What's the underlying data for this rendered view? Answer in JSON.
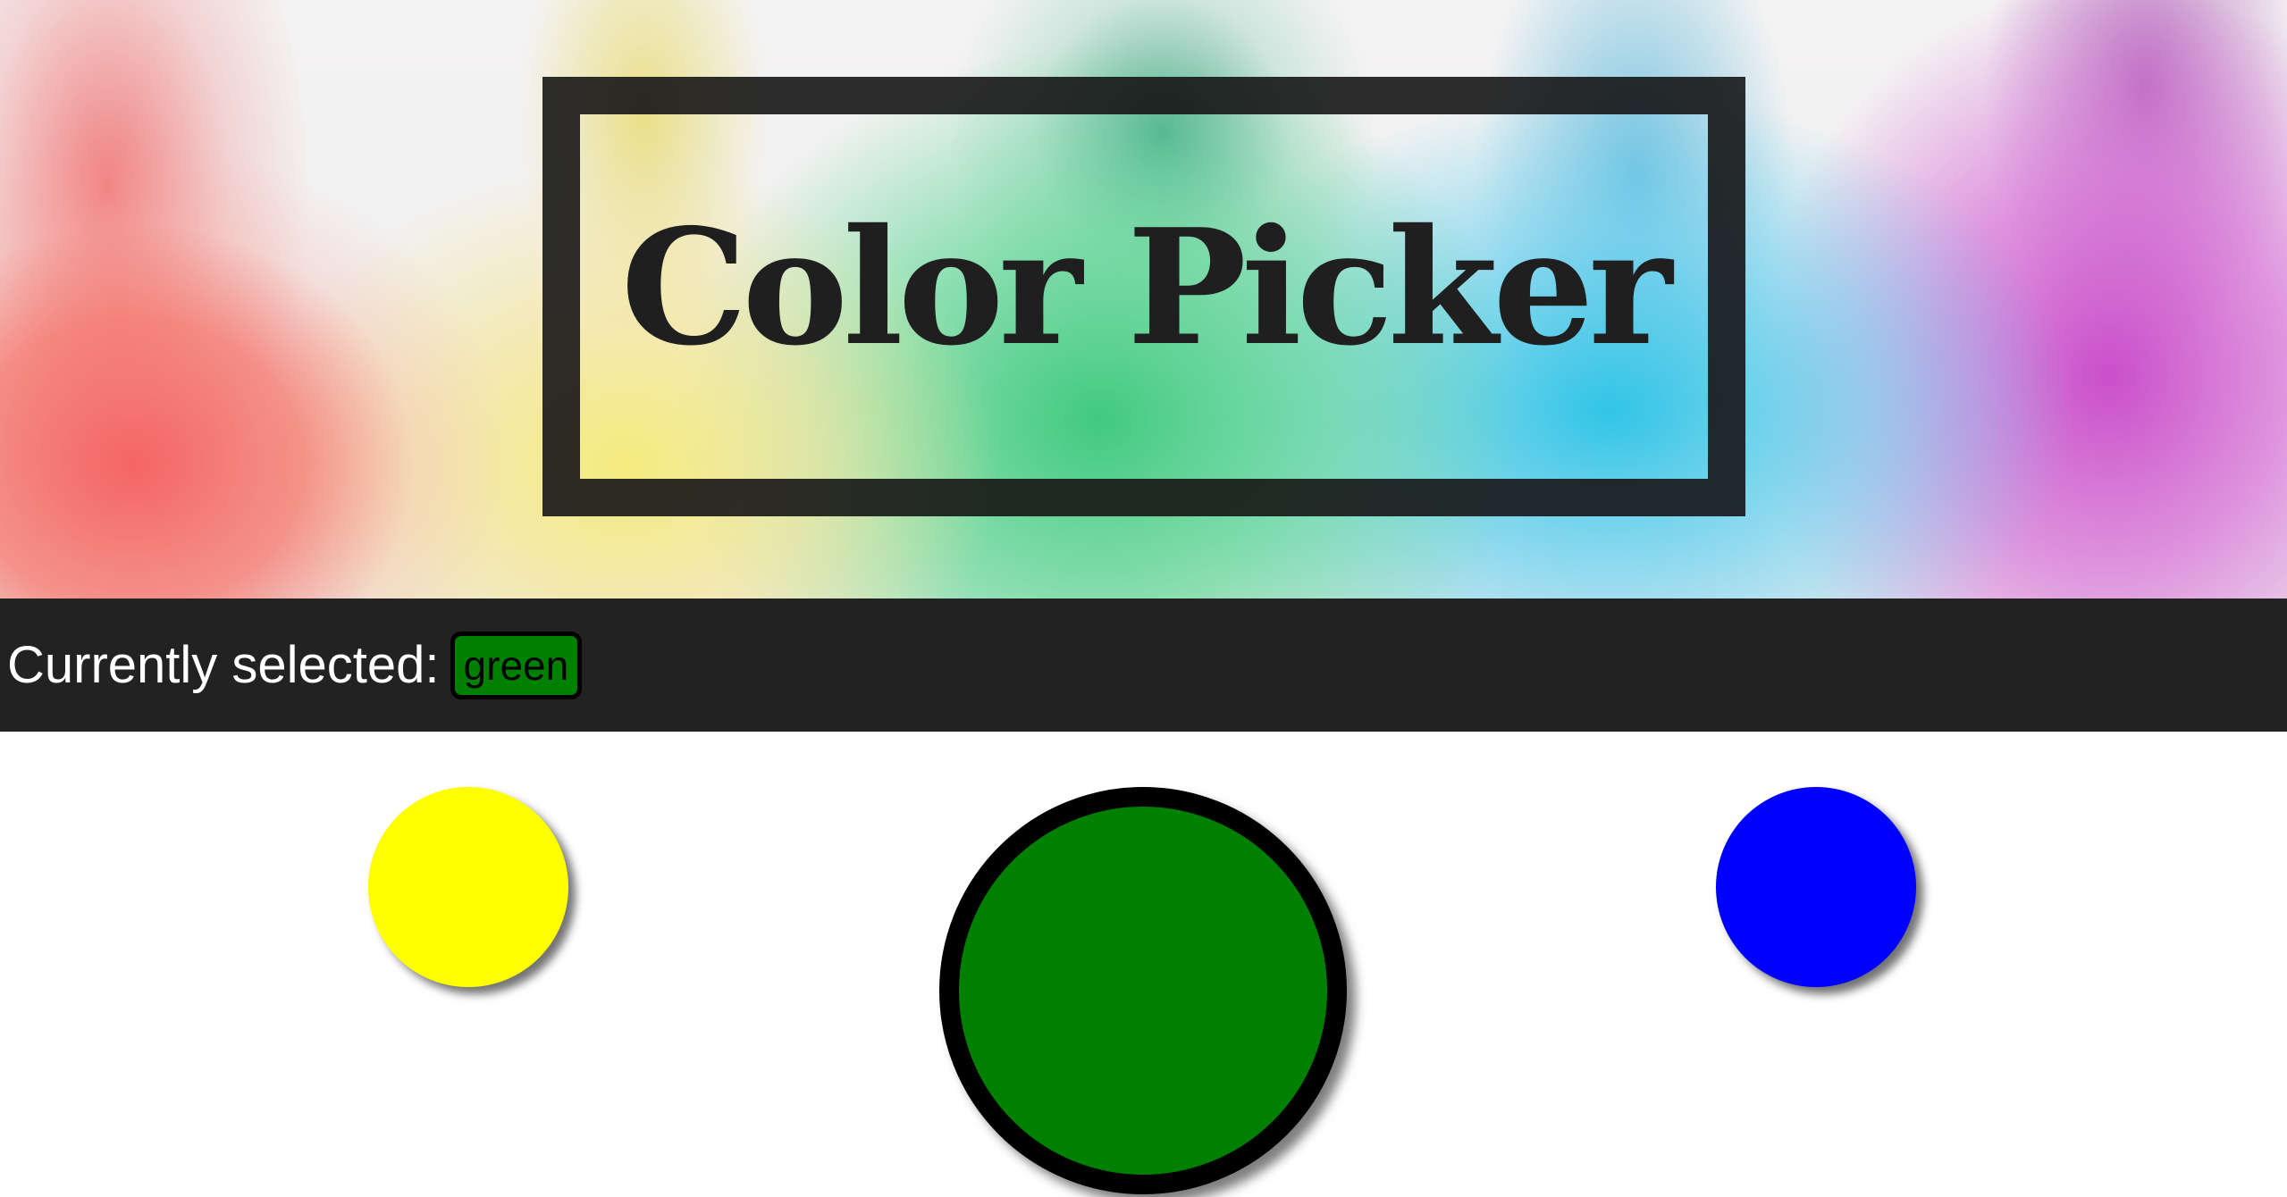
{
  "hero": {
    "title": "Color Picker"
  },
  "status": {
    "label": "Currently selected:",
    "selected_value": "green",
    "selected_color": "#008000"
  },
  "swatches": [
    {
      "name": "yellow",
      "color": "#ffff00",
      "selected": false
    },
    {
      "name": "green",
      "color": "#008000",
      "selected": true
    },
    {
      "name": "blue",
      "color": "#0000ff",
      "selected": false
    }
  ]
}
